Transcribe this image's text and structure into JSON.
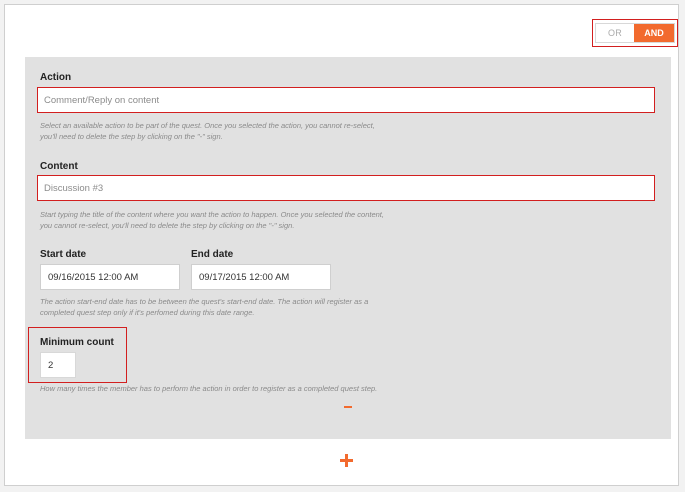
{
  "toggle": {
    "or_label": "OR",
    "and_label": "AND",
    "selected": "AND"
  },
  "action": {
    "label": "Action",
    "value": "Comment/Reply on content",
    "help_line1": "Select an available action to be part of the quest. Once you selected the action, you cannot re-select,",
    "help_line2": "you'll need to delete the step by clicking on the \"-\" sign."
  },
  "content": {
    "label": "Content",
    "value": "Discussion #3",
    "help_line1": "Start typing the title of the content where you want the action to happen. Once you selected the content,",
    "help_line2": "you cannot re-select, you'll need to delete the step by clicking on the \"-\" sign."
  },
  "start_date": {
    "label": "Start date",
    "value": "09/16/2015 12:00 AM"
  },
  "end_date": {
    "label": "End date",
    "value": "09/17/2015 12:00 AM"
  },
  "date_help_line1": "The action start-end date has to be between the quest's start-end date. The action will register as a",
  "date_help_line2": "completed quest step only if it's perfomed during this date range.",
  "minimum_count": {
    "label": "Minimum count",
    "value": "2",
    "help": "How many times the member has to perform the action in order to register as a completed quest step."
  },
  "colors": {
    "accent": "#f26a2e",
    "highlight": "#d21f1f",
    "panel": "#e1e1e1"
  },
  "icons": {
    "remove": "minus-icon",
    "add": "plus-icon"
  }
}
